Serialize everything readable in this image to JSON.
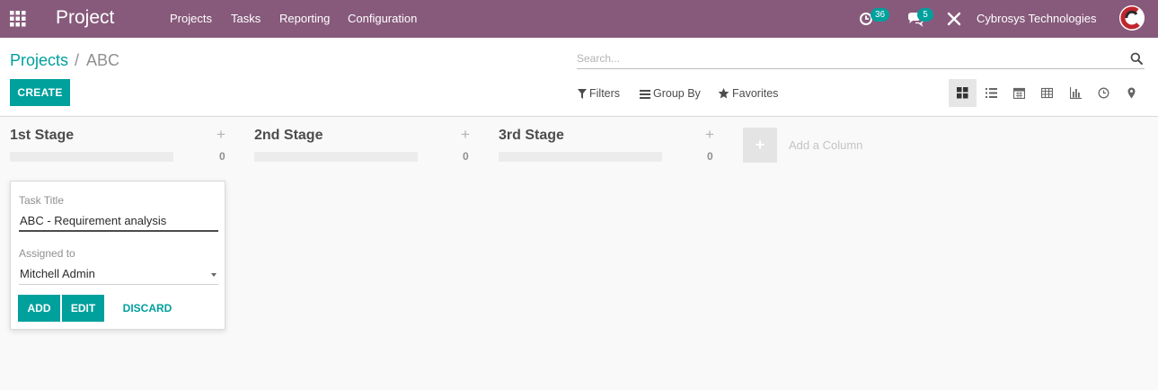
{
  "navbar": {
    "app_title": "Project",
    "menu": [
      "Projects",
      "Tasks",
      "Reporting",
      "Configuration"
    ],
    "activity_badge": "36",
    "messages_badge": "5",
    "company": "Cybrosys Technologies",
    "icons": [
      "apps-grid-icon",
      "activity-clock-icon",
      "chat-icon",
      "debug-tools-icon",
      "user-avatar"
    ]
  },
  "breadcrumb": {
    "parent": "Projects",
    "separator": "/",
    "current": "ABC"
  },
  "actions": {
    "create_label": "CREATE"
  },
  "search": {
    "placeholder": "Search..."
  },
  "filters": {
    "filters_label": "Filters",
    "group_by_label": "Group By",
    "favorites_label": "Favorites"
  },
  "views": [
    "kanban-view-icon",
    "list-view-icon",
    "calendar-view-icon",
    "pivot-view-icon",
    "graph-view-icon",
    "activity-view-icon",
    "map-view-icon"
  ],
  "kanban": {
    "columns": [
      {
        "title": "1st Stage",
        "count": "0"
      },
      {
        "title": "2nd Stage",
        "count": "0"
      },
      {
        "title": "3rd Stage",
        "count": "0"
      }
    ],
    "add_column_label": "Add a Column"
  },
  "quick_create": {
    "task_title_label": "Task Title",
    "task_title_value": "ABC - Requirement analysis",
    "assigned_label": "Assigned to",
    "assigned_value": "Mitchell Admin",
    "add_label": "ADD",
    "edit_label": "EDIT",
    "discard_label": "DISCARD"
  },
  "colors": {
    "navbar": "#875a7b",
    "primary": "#00a09d",
    "background": "#f9f9f9"
  }
}
